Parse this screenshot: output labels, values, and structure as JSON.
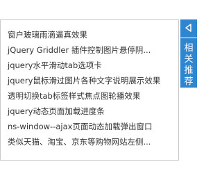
{
  "links": [
    "窗户玻璃雨滴逼真效果",
    "jQuery Griddler 插件控制图片悬停阴...",
    "jquery水平滑动tab选项卡",
    "jquery鼠标滑过图片各种文字说明展示效果",
    "透明切换tab标签样式焦点图轮播效果",
    "jquery动态页面加载进度条",
    "ns-window--ajax页面动态加载弹出窗口",
    "类似天猫、淘宝、京东等购物网站左侧..."
  ],
  "side_tab": {
    "label": "相关推荐",
    "arrow_icon": "triangle-left-icon"
  },
  "colors": {
    "accent": "#2f86d0",
    "border": "#c9c9c9",
    "text": "#333333"
  }
}
